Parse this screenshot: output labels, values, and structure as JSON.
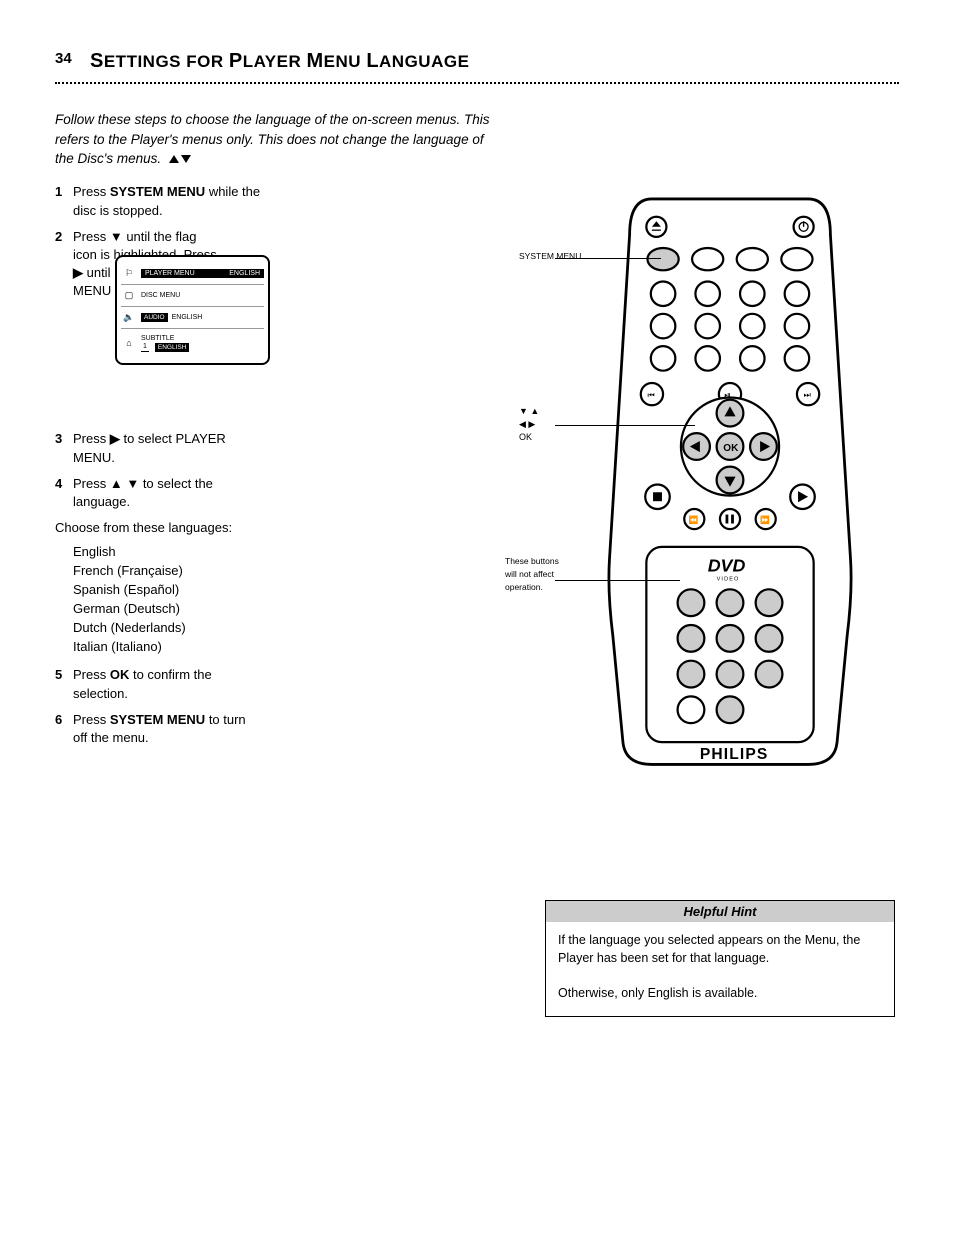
{
  "page_number": "34",
  "page_title_pre": "S",
  "page_title_rest": "ETTINGS FOR",
  "page_title_pre2": "P",
  "page_title_rest2": "LAYER",
  "page_title_pre3": "M",
  "page_title_rest3": "ENU",
  "page_title_pre4": "L",
  "page_title_rest4": "ANGUAGE",
  "intro": "Follow these steps to choose the language of the on-screen menus. This refers to the Player's menus only. This does not change the language of the Disc's menus.",
  "arrows": "pq",
  "steps": {
    "s1_a": "Press ",
    "s1_b": "SYSTEM MENU ",
    "s1_c": "while the",
    "s1_d": "disc is stopped.",
    "s2_a": "Press ",
    "s2_b": " until the flag",
    "s2_c": "icon is highlighted. Press",
    "s2_d": " until LANGUAGE",
    "s2_e": "MENU is selected.",
    "s3_a": "Press ",
    "s3_b": " to select PLAYER",
    "s3_c": "MENU.",
    "s4_a": "Press ",
    "s4_b": " to select the",
    "s4_c": "language.",
    "s5_a": "Press ",
    "s5_b": "OK ",
    "s5_c": "to confirm the",
    "s5_d": "selection.",
    "s6_a": "Press ",
    "s6_b": "SYSTEM MENU ",
    "s6_c": "to turn",
    "s6_d": "off the menu.",
    "choose": "Choose from these languages:",
    "l1": "English",
    "l2": "French (Française)",
    "l3": "Spanish (Español)",
    "l4": "German (Deutsch)",
    "l5": "Dutch (Nederlands)",
    "l6": "Italian (Italiano)"
  },
  "screen": {
    "row1_l": "PLAYER MENU",
    "row1_r": "ENGLISH",
    "row2": "DISC MENU",
    "row3": "AUDIO",
    "row3_v": "ENGLISH",
    "row4": "SUBTITLE",
    "row4a": "1",
    "row4b": "ENGLISH",
    "icon_flag": "⚐",
    "icon_screen": "▢",
    "icon_sound": "🔈",
    "icon_lock": "⌂"
  },
  "callouts": {
    "c1": "SYSTEM MENU",
    "c2a": "▼ ▲",
    "c2b": "◀ ▶",
    "c2c": "OK",
    "c3": "These buttons will not affect operation."
  },
  "tip": {
    "header": "Helpful Hint",
    "body_a": "If the language you selected appears on the Menu, the Player has been set for that language.",
    "body_b": "Otherwise, only English is available."
  },
  "brand": "PHILIPS",
  "dvd_logo": "DVD",
  "dvd_sub": "VIDEO"
}
